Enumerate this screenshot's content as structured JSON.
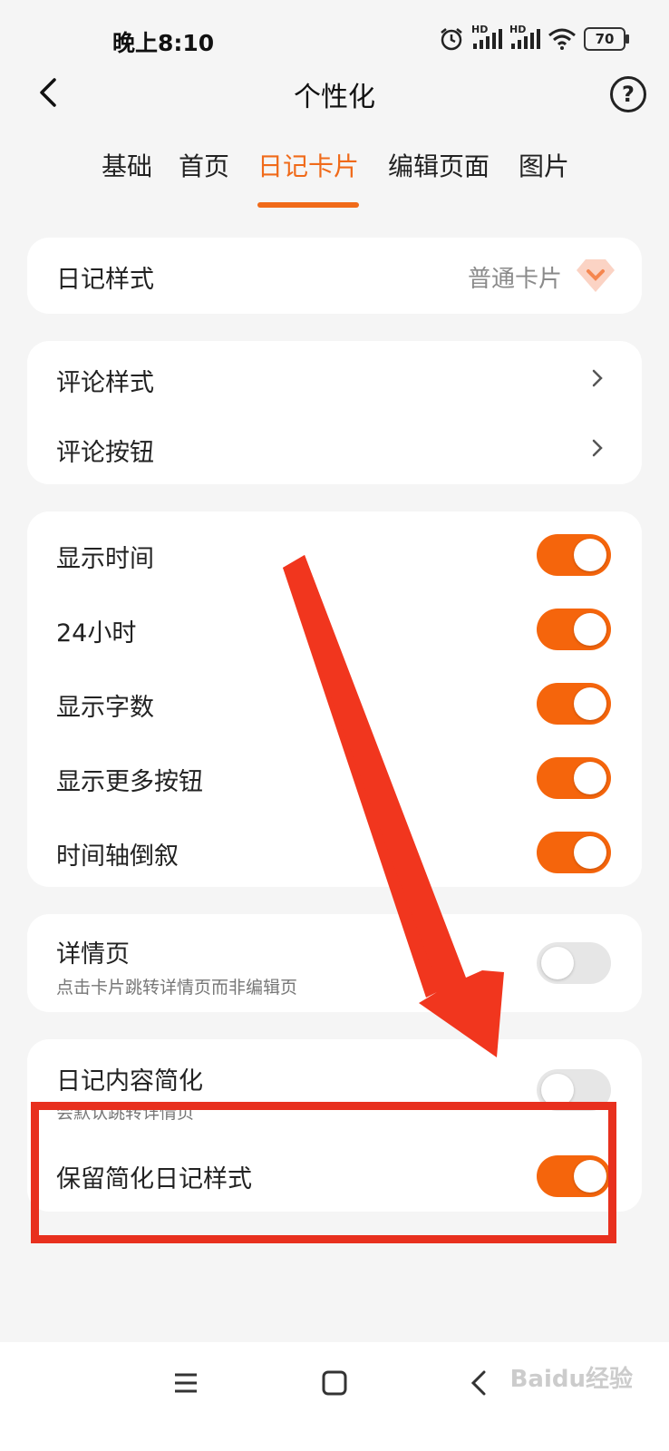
{
  "status": {
    "time": "晚上8:10",
    "battery": "70",
    "signal_labels": [
      "HD",
      "HD"
    ]
  },
  "header": {
    "title": "个性化",
    "back_icon": "back-arrow-icon",
    "help_icon": "question-icon",
    "help_symbol": "?"
  },
  "tabs": [
    {
      "label": "基础",
      "active": false
    },
    {
      "label": "首页",
      "active": false
    },
    {
      "label": "日记卡片",
      "active": true
    },
    {
      "label": "编辑页面",
      "active": false
    },
    {
      "label": "图片",
      "active": false
    }
  ],
  "diary_style": {
    "label": "日记样式",
    "value": "普通卡片",
    "badge_icon": "diamond-icon"
  },
  "comments": [
    {
      "label": "评论样式"
    },
    {
      "label": "评论按钮"
    }
  ],
  "display_toggles": [
    {
      "label": "显示时间",
      "on": true
    },
    {
      "label": "24小时",
      "on": true
    },
    {
      "label": "显示字数",
      "on": true
    },
    {
      "label": "显示更多按钮",
      "on": true
    },
    {
      "label": "时间轴倒叙",
      "on": true
    }
  ],
  "detail": {
    "label": "详情页",
    "sub": "点击卡片跳转详情页而非编辑页",
    "on": false
  },
  "simplify": {
    "label": "日记内容简化",
    "sub": "会默认跳转详情页",
    "on": false,
    "keep_label": "保留简化日记样式",
    "keep_on": true
  },
  "watermark": "Baidu经验",
  "colors": {
    "accent": "#f06a19",
    "toggle_on": "#f5650c",
    "annotation": "#e8301e"
  }
}
